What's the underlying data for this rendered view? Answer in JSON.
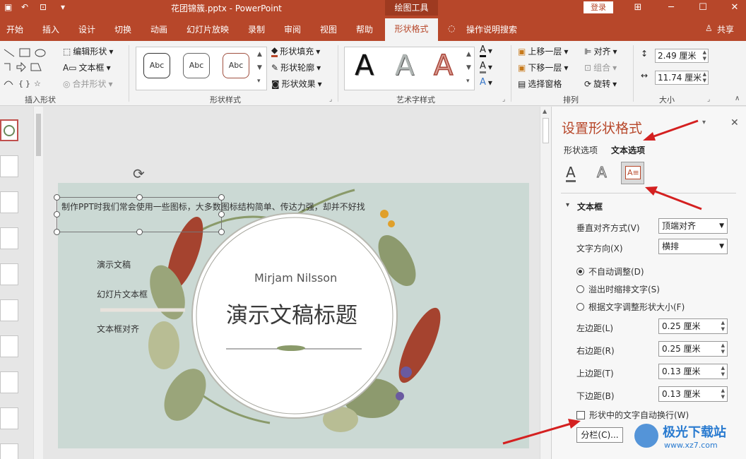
{
  "titlebar": {
    "doc_title": "花团锦簇.pptx  -  PowerPoint",
    "tools_tab": "绘图工具",
    "login": "登录"
  },
  "menu": {
    "items": [
      "开始",
      "插入",
      "设计",
      "切换",
      "动画",
      "幻灯片放映",
      "录制",
      "审阅",
      "视图",
      "帮助"
    ],
    "active": "形状格式",
    "search": "操作说明搜索",
    "share": "共享"
  },
  "ribbon": {
    "insert_shapes": {
      "label": "插入形状",
      "edit_shape": "编辑形状",
      "text_box": "文本框",
      "merge_shapes": "合并形状"
    },
    "shape_styles": {
      "label": "形状样式",
      "samples": [
        "Abc",
        "Abc",
        "Abc"
      ],
      "fill": "形状填充",
      "outline": "形状轮廓",
      "effects": "形状效果"
    },
    "wordart": {
      "label": "艺术字样式",
      "samples": [
        "A",
        "A",
        "A"
      ]
    },
    "arrange": {
      "label": "排列",
      "bring_forward": "上移一层",
      "send_backward": "下移一层",
      "selection_pane": "选择窗格",
      "align": "对齐",
      "group": "组合",
      "rotate": "旋转"
    },
    "size": {
      "label": "大小",
      "height": "2.49 厘米",
      "width": "11.74 厘米"
    }
  },
  "slide": {
    "textbox": "制作PPT时我们常会使用一些图标，大多数图标结构简单、传达力强，却并不好找",
    "items": [
      "演示文稿",
      "幻灯片文本框",
      "文本框对齐"
    ],
    "author": "Mirjam Nilsson",
    "title": "演示文稿标题"
  },
  "pane": {
    "title": "设置形状格式",
    "tabs": [
      "形状选项",
      "文本选项"
    ],
    "section": "文本框",
    "valign_label": "垂直对齐方式(V)",
    "valign_value": "顶端对齐",
    "direction_label": "文字方向(X)",
    "direction_value": "横排",
    "radios": [
      "不自动调整(D)",
      "溢出时缩排文字(S)",
      "根据文字调整形状大小(F)"
    ],
    "margins": [
      {
        "label": "左边距(L)",
        "value": "0.25 厘米"
      },
      {
        "label": "右边距(R)",
        "value": "0.25 厘米"
      },
      {
        "label": "上边距(T)",
        "value": "0.13 厘米"
      },
      {
        "label": "下边距(B)",
        "value": "0.13 厘米"
      }
    ],
    "wrap_label": "形状中的文字自动换行(W)",
    "columns_button": "分栏(C)..."
  },
  "watermark": {
    "name": "极光下载站",
    "url": "www.xz7.com"
  },
  "colors": {
    "accent": "#b7472a",
    "pane_title": "#b7472a",
    "arrow": "#d42020",
    "slide_bg": "#cbd9d4"
  }
}
